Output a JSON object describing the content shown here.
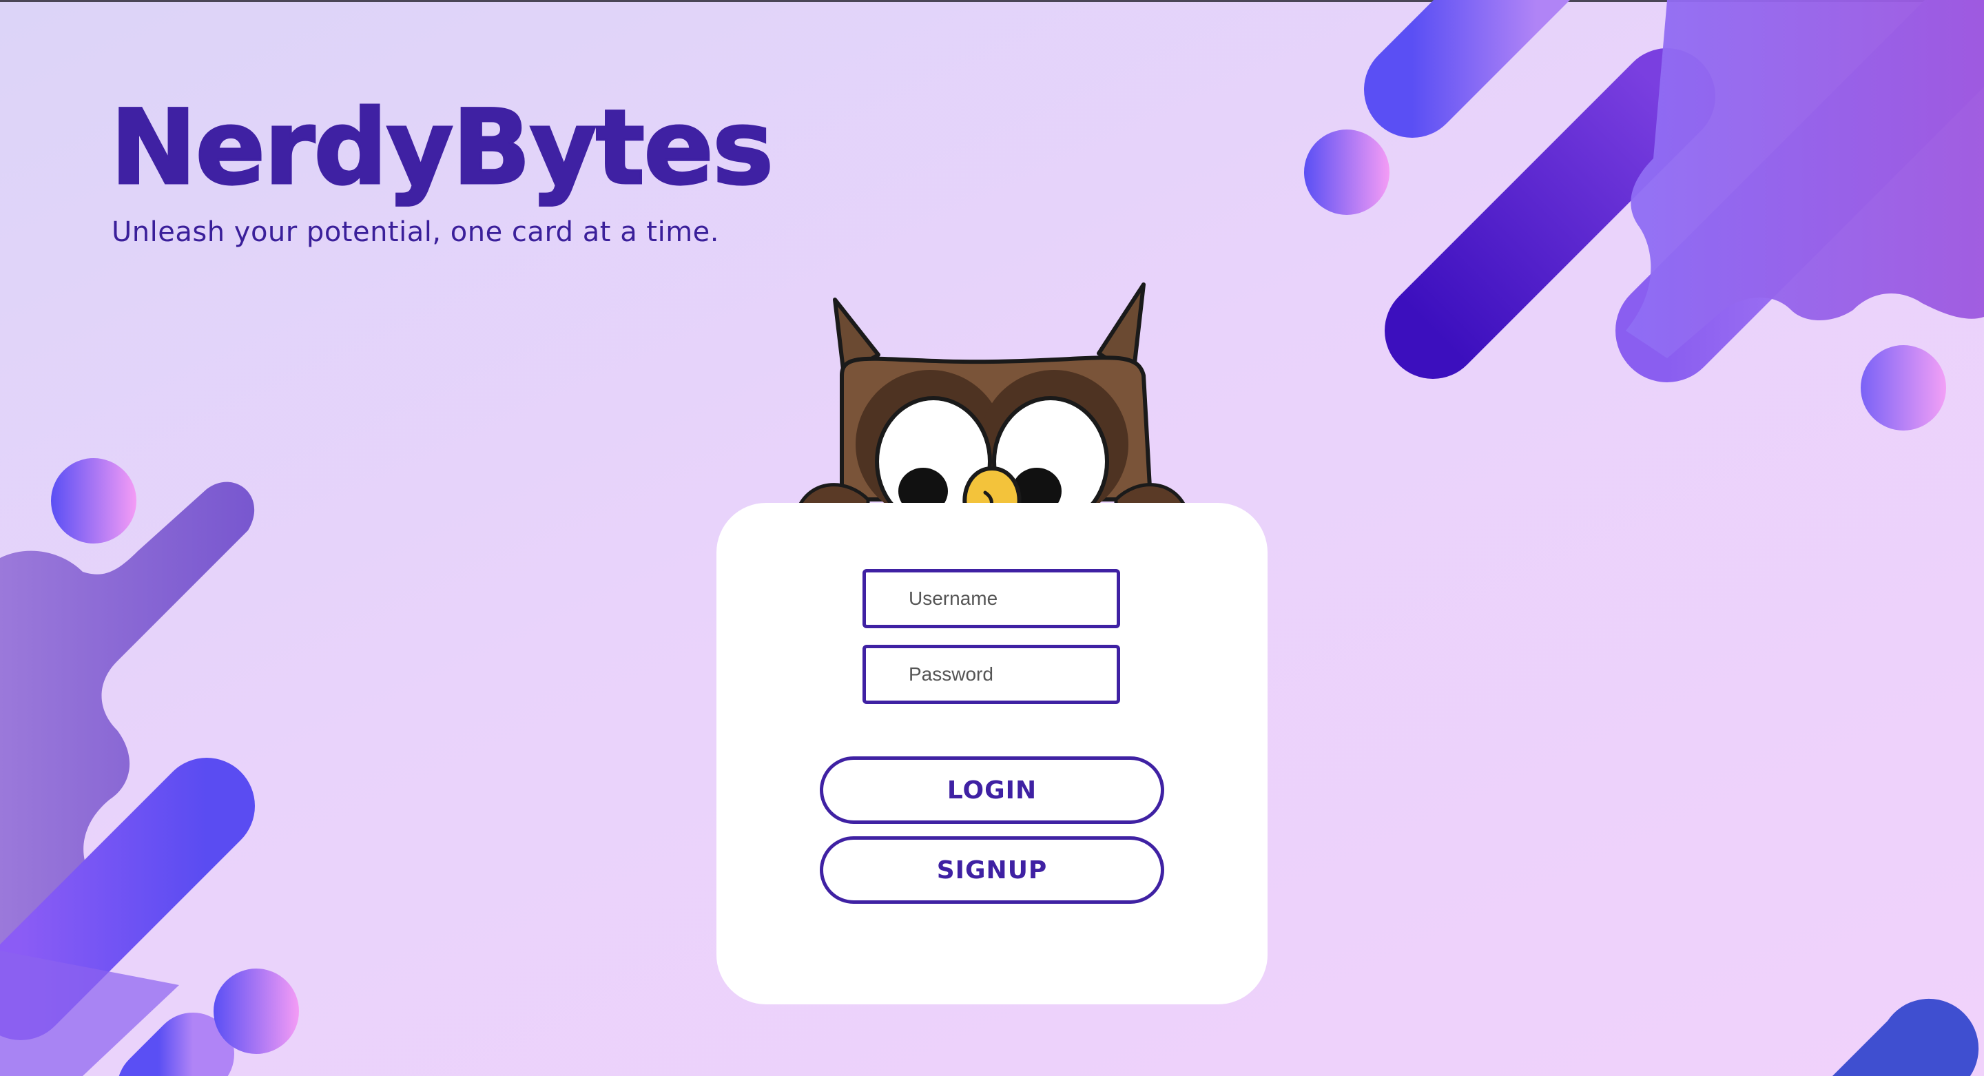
{
  "brand": {
    "title": "NerdyBytes",
    "tagline": "Unleash your potential, one card at a time."
  },
  "login_form": {
    "username_placeholder": "Username",
    "password_placeholder": "Password",
    "login_label": "LOGIN",
    "signup_label": "SIGNUP"
  },
  "mascot": {
    "icon": "owl-mascot"
  },
  "colors": {
    "brand_purple": "#3f21a3",
    "card_bg": "#ffffff",
    "background": "#e9d3fb"
  }
}
